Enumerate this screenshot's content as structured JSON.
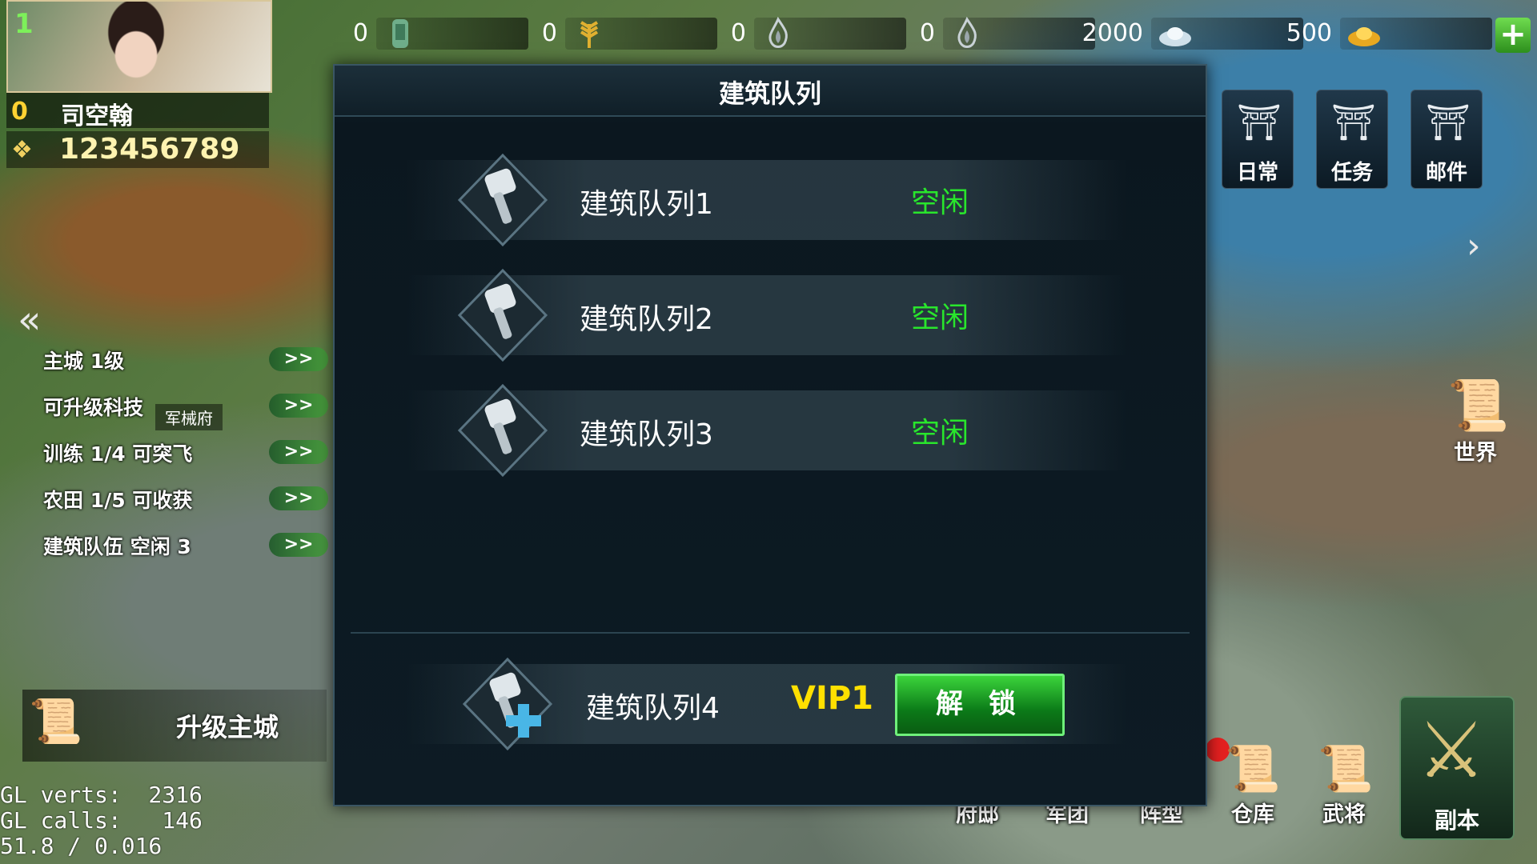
{
  "resources": [
    {
      "icon": "jade-token-icon",
      "value": "0"
    },
    {
      "icon": "grain-icon",
      "value": "0"
    },
    {
      "icon": "spirit-flame-icon",
      "value": "0"
    },
    {
      "icon": "spirit-flame-icon",
      "value": "0"
    },
    {
      "icon": "silver-ingot-icon",
      "value": "2000"
    },
    {
      "icon": "gold-ingot-icon",
      "value": "500"
    }
  ],
  "player": {
    "level": "1",
    "vip": "0",
    "name": "司空翰",
    "power": "123456789"
  },
  "quests": [
    {
      "label": "主城  1级",
      "go": ">>"
    },
    {
      "label": "可升级科技",
      "go": ">>"
    },
    {
      "label": "训练 1/4 可突飞",
      "go": ">>"
    },
    {
      "label": "农田 1/5 可收获",
      "go": ">>"
    },
    {
      "label": "建筑队伍 空闲 3",
      "go": ">>"
    }
  ],
  "building_tag": "军械府",
  "upgrade_city": "升级主城",
  "debug": {
    "line1": "GL verts:  2316",
    "line2": "GL calls:   146",
    "line3": "51.8 / 0.016"
  },
  "right_menu": [
    {
      "label": "日常"
    },
    {
      "label": "任务"
    },
    {
      "label": "邮件"
    }
  ],
  "world_label": "世界",
  "bottom_nav": [
    {
      "label": "府邸"
    },
    {
      "label": "军团"
    },
    {
      "label": "阵型"
    },
    {
      "label": "仓库"
    },
    {
      "label": "武将"
    }
  ],
  "dungeon_label": "副本",
  "modal": {
    "title": "建筑队列",
    "queues": [
      {
        "name": "建筑队列1",
        "status": "空闲"
      },
      {
        "name": "建筑队列2",
        "status": "空闲"
      },
      {
        "name": "建筑队列3",
        "status": "空闲"
      }
    ],
    "locked": {
      "name": "建筑队列4",
      "requirement": "VIP1",
      "button": "解 锁"
    }
  },
  "colors": {
    "status_idle": "#29e62c",
    "vip_requirement": "#ffe000",
    "unlock_button": "#1aa62a"
  }
}
